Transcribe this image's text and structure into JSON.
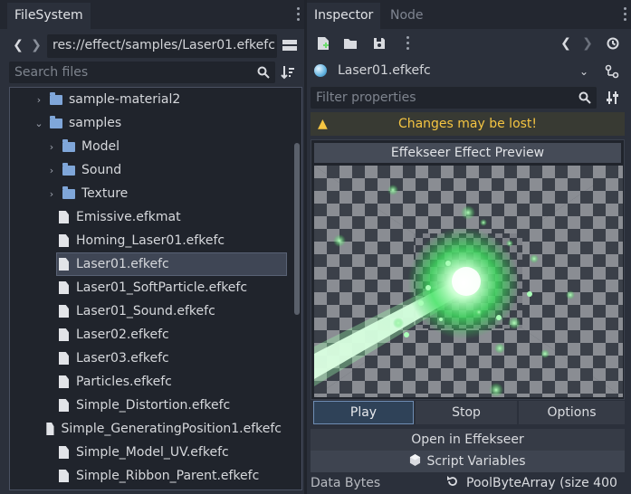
{
  "filesystem": {
    "tab_label": "FileSystem",
    "path": "res://effect/samples/Laser01.efkefc",
    "search_placeholder": "Search files",
    "tree": [
      {
        "label": "sample-material2",
        "type": "folder",
        "indent": 1,
        "arrow": "›"
      },
      {
        "label": "samples",
        "type": "folder",
        "indent": 1,
        "arrow": "⌄"
      },
      {
        "label": "Model",
        "type": "folder",
        "indent": 2,
        "arrow": "›"
      },
      {
        "label": "Sound",
        "type": "folder",
        "indent": 2,
        "arrow": "›"
      },
      {
        "label": "Texture",
        "type": "folder",
        "indent": 2,
        "arrow": "›"
      },
      {
        "label": "Emissive.efkmat",
        "type": "file",
        "indent": 2
      },
      {
        "label": "Homing_Laser01.efkefc",
        "type": "file",
        "indent": 2
      },
      {
        "label": "Laser01.efkefc",
        "type": "file",
        "indent": 2,
        "selected": true
      },
      {
        "label": "Laser01_SoftParticle.efkefc",
        "type": "file",
        "indent": 2
      },
      {
        "label": "Laser01_Sound.efkefc",
        "type": "file",
        "indent": 2
      },
      {
        "label": "Laser02.efkefc",
        "type": "file",
        "indent": 2
      },
      {
        "label": "Laser03.efkefc",
        "type": "file",
        "indent": 2
      },
      {
        "label": "Particles.efkefc",
        "type": "file",
        "indent": 2
      },
      {
        "label": "Simple_Distortion.efkefc",
        "type": "file",
        "indent": 2
      },
      {
        "label": "Simple_GeneratingPosition1.efkefc",
        "type": "file",
        "indent": 2
      },
      {
        "label": "Simple_Model_UV.efkefc",
        "type": "file",
        "indent": 2
      },
      {
        "label": "Simple_Ribbon_Parent.efkefc",
        "type": "file",
        "indent": 2
      }
    ]
  },
  "inspector": {
    "tabs": [
      "Inspector",
      "Node"
    ],
    "resource_name": "Laser01.efkefc",
    "filter_placeholder": "Filter properties",
    "warning": "Changes may be lost!",
    "preview_title": "Effekseer Effect Preview",
    "buttons": {
      "play": "Play",
      "stop": "Stop",
      "options": "Options"
    },
    "open_in": "Open in Effekseer",
    "script_variables": "Script Variables",
    "property": {
      "name": "Data Bytes",
      "value": "PoolByteArray (size 400"
    }
  },
  "colors": {
    "accent": "#6f8db3",
    "warning": "#f5c542",
    "folder": "#7fa6d9",
    "glow": "#7dff8a"
  }
}
